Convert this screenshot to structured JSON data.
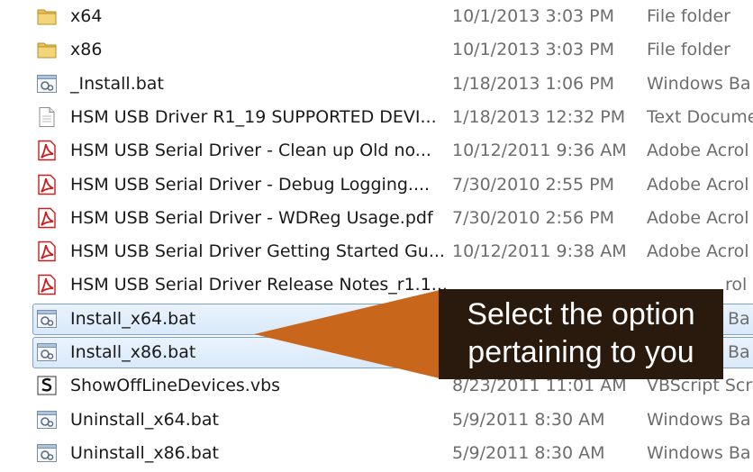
{
  "files": [
    {
      "name": "x64",
      "date": "10/1/2013 3:03 PM",
      "type": "File folder",
      "icon": "folder-icon"
    },
    {
      "name": "x86",
      "date": "10/1/2013 3:03 PM",
      "type": "File folder",
      "icon": "folder-icon"
    },
    {
      "name": "_Install.bat",
      "date": "1/18/2013 1:06 PM",
      "type": "Windows Ba",
      "icon": "batch-file-icon"
    },
    {
      "name": "HSM USB Driver R1_19 SUPPORTED DEVI...",
      "date": "1/18/2013 12:32 PM",
      "type": "Text Docume",
      "icon": "text-document-icon"
    },
    {
      "name": "HSM USB Serial Driver - Clean up Old no...",
      "date": "10/12/2011 9:36 AM",
      "type": "Adobe Acrol",
      "icon": "pdf-icon"
    },
    {
      "name": "HSM USB Serial Driver - Debug Logging....",
      "date": "7/30/2010 2:55 PM",
      "type": "Adobe Acrol",
      "icon": "pdf-icon"
    },
    {
      "name": "HSM USB Serial Driver - WDReg Usage.pdf",
      "date": "7/30/2010 2:56 PM",
      "type": "Adobe Acrol",
      "icon": "pdf-icon"
    },
    {
      "name": "HSM USB Serial Driver Getting Started Gu...",
      "date": "10/12/2011 9:38 AM",
      "type": "Adobe Acrol",
      "icon": "pdf-icon"
    },
    {
      "name": "HSM USB Serial Driver Release Notes_r1.1...",
      "date": "",
      "type": "rol",
      "icon": "pdf-icon"
    },
    {
      "name": "Install_x64.bat",
      "date": "",
      "type": "Ba",
      "icon": "batch-file-icon",
      "selected": true
    },
    {
      "name": "Install_x86.bat",
      "date": "",
      "type": "Ba",
      "icon": "batch-file-icon",
      "selected": true
    },
    {
      "name": "ShowOffLineDevices.vbs",
      "date": "8/23/2011 11:01 AM",
      "type": "VBScript Scri",
      "icon": "vbscript-icon"
    },
    {
      "name": "Uninstall_x64.bat",
      "date": "5/9/2011 8:30 AM",
      "type": "Windows Ba",
      "icon": "batch-file-icon"
    },
    {
      "name": "Uninstall_x86.bat",
      "date": "5/9/2011 8:30 AM",
      "type": "Windows Ba",
      "icon": "batch-file-icon"
    }
  ],
  "callout": {
    "line1": "Select the option",
    "line2": "pertaining to you",
    "color": "#c8661c",
    "box_color": "#2a1a0d"
  },
  "colors": {
    "selection_fill": "#dbe9fa",
    "selection_border": "#7da2ce",
    "folder": "#e8c15a",
    "pdf_red": "#c81e1e"
  }
}
